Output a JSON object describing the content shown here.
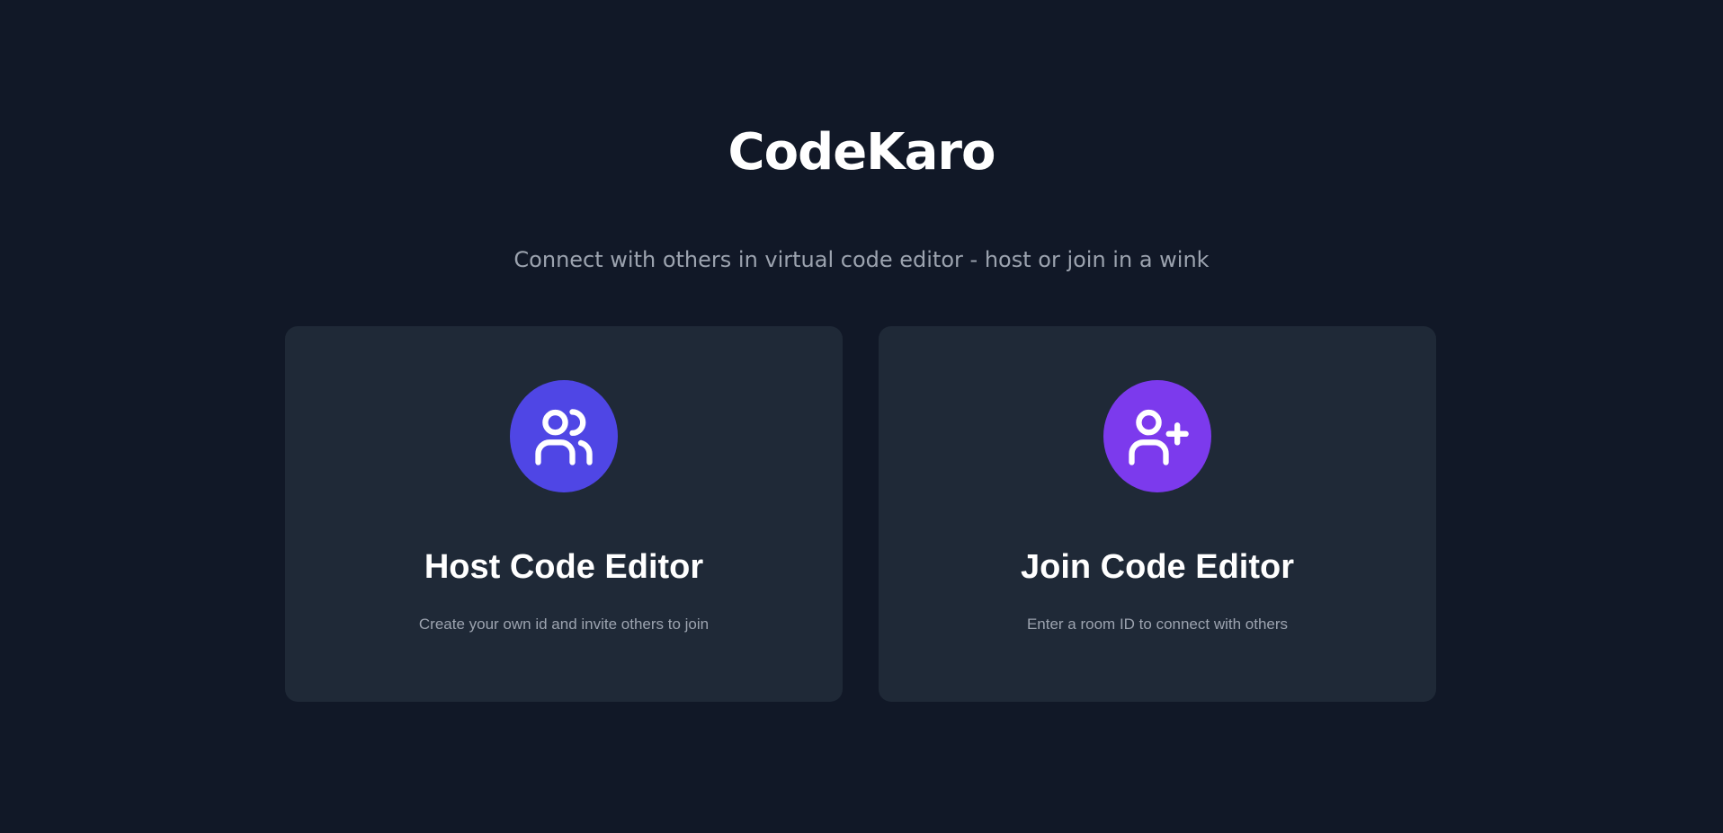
{
  "app": {
    "title": "CodeKaro",
    "subtitle": "Connect with others in virtual code editor - host or join in a wink"
  },
  "cards": [
    {
      "title": "Host Code Editor",
      "description": "Create your own id and invite others to join",
      "icon": "users-icon",
      "icon_bg": "#4f46e5"
    },
    {
      "title": "Join Code Editor",
      "description": "Enter a room ID to connect with others",
      "icon": "user-plus-icon",
      "icon_bg": "#7c3aed"
    }
  ],
  "colors": {
    "background": "#111827",
    "card": "#1f2937",
    "text_primary": "#ffffff",
    "text_secondary": "#9ca3af"
  }
}
